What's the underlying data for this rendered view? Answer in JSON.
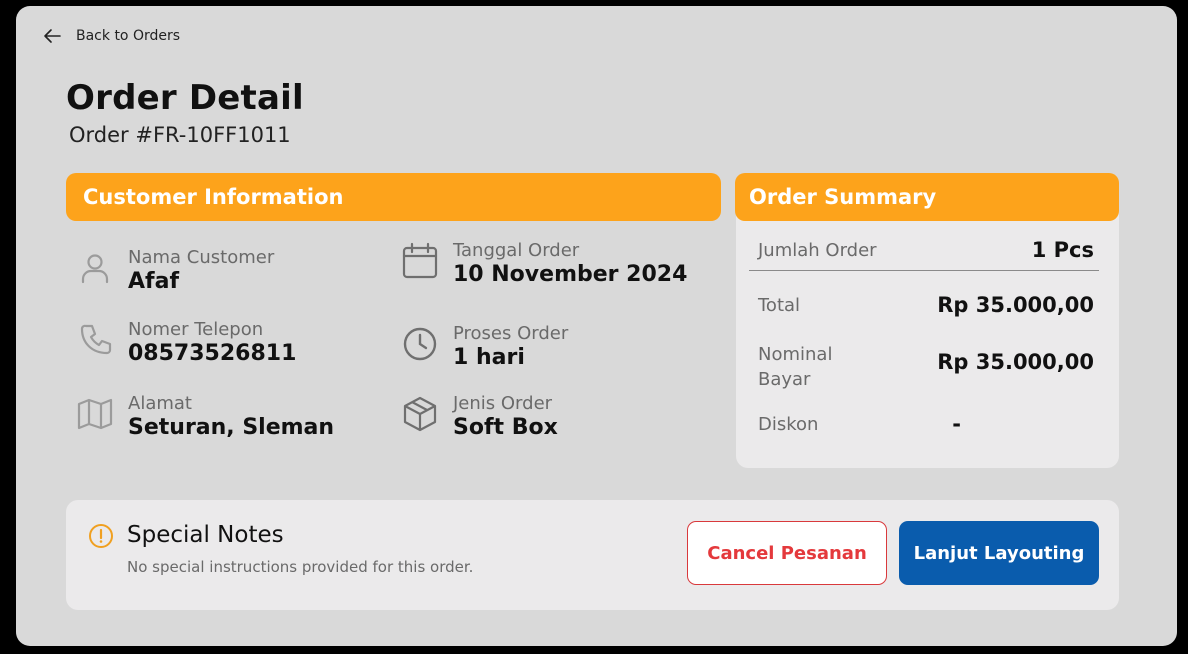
{
  "nav": {
    "back_label": "Back to Orders"
  },
  "header": {
    "title": "Order Detail",
    "order_number": "Order #FR-10FF1011"
  },
  "customer_info": {
    "heading": "Customer Information",
    "fields": [
      {
        "label": "Nama Customer",
        "value": "Afaf",
        "icon": "user-icon"
      },
      {
        "label": "Nomer Telepon",
        "value": "08573526811",
        "icon": "phone-icon"
      },
      {
        "label": "Alamat",
        "value": "Seturan, Sleman",
        "icon": "map-icon"
      },
      {
        "label": "Tanggal Order",
        "value": "10 November 2024",
        "icon": "calendar-icon"
      },
      {
        "label": "Proses Order",
        "value": "1 hari",
        "icon": "clock-icon"
      },
      {
        "label": "Jenis Order",
        "value": "Soft Box",
        "icon": "box-icon"
      }
    ]
  },
  "order_summary": {
    "heading": "Order Summary",
    "rows": [
      {
        "label": "Jumlah Order",
        "value": "1 Pcs"
      },
      {
        "label": "Total",
        "value": "Rp 35.000,00"
      },
      {
        "label": "Nominal\nBayar",
        "value": "Rp 35.000,00"
      },
      {
        "label": "Diskon",
        "value": "-"
      }
    ]
  },
  "notes": {
    "title": "Special Notes",
    "description": "No special instructions provided for this order.",
    "icon": "warning-icon"
  },
  "actions": {
    "cancel_label": "Cancel Pesanan",
    "next_label": "Lanjut Layouting"
  },
  "colors": {
    "accent_orange": "#fda31b",
    "primary_blue": "#0a5cad",
    "danger_red": "#e4393c",
    "panel_bg": "#d9d9d9",
    "card_bg": "#ebeaeb"
  }
}
